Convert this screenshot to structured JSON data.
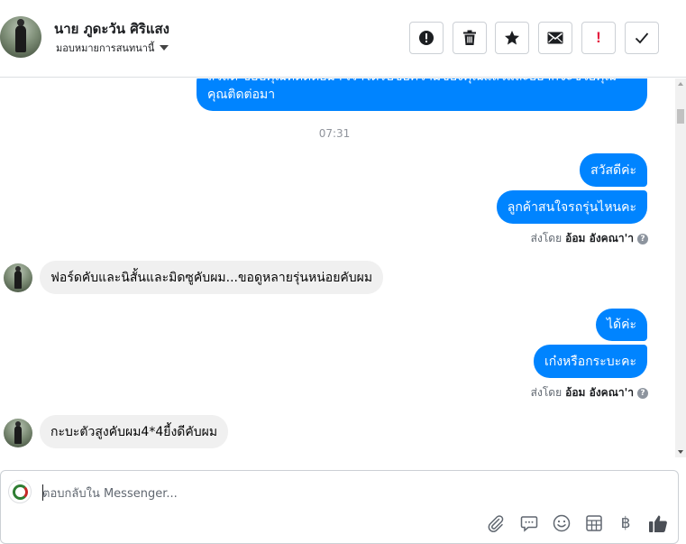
{
  "header": {
    "contact_name": "นาย ภูดะวัน ศิริแสง",
    "assign_label": "มอบหมายการสนทนานี้",
    "buttons": {
      "report": "!",
      "flag": "!"
    }
  },
  "conversation": {
    "partial_message_line1": "สวัสดี ขอบคุณที่ติดต่อมา เราได้รับข้อความของคุณแล้วและอยากจะช่วยคุณ",
    "partial_message_line2": "คุณติดต่อมา",
    "timestamp": "07:31",
    "outgoing_1": "สวัสดีค่ะ",
    "outgoing_2": "ลูกค้าสนใจรถรุ่นไหนคะ",
    "sent_by_prefix": "ส่งโดย",
    "sent_by_name": "อ้อม อังคณา'า",
    "incoming_1": "ฟอร์ดคับและนิสั้นและมิดซูคับผม...ขอดูหลายรุ่นหน่อยคับผม",
    "outgoing_3": "ได้ค่ะ",
    "outgoing_4": "เก๋งหรือกระบะคะ",
    "incoming_2": "กะบะตัวสูงคับผม4*4ยี้งดีคับผม",
    "help_glyph": "?"
  },
  "composer": {
    "placeholder": "ตอบกลับใน Messenger...",
    "currency_glyph": "฿"
  },
  "colors": {
    "outgoing_bubble": "#0084ff",
    "incoming_bubble": "#f0f0f0",
    "flag_red": "#e41e3f"
  }
}
